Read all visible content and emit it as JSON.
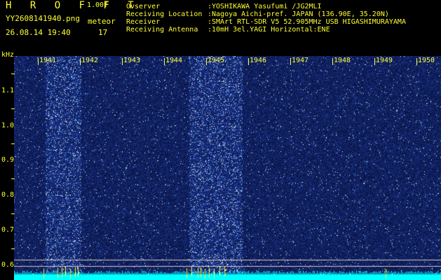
{
  "header": {
    "app_title": "H R O F F T",
    "version": "1.00f",
    "file_name": "YY2608141940.png",
    "meteor_label": "meteor",
    "timestamp": "26.08.14 19:40",
    "meteor_count": "17"
  },
  "info": [
    {
      "key": "Ovserver",
      "value": ":YOSHIKAWA Yasufumi /JG2MLI"
    },
    {
      "key": "Receiving Location",
      "value": ":Nagoya Aichi-pref. JAPAN (136.90E, 35.20N)"
    },
    {
      "key": "Receiver",
      "value": ":SMArt RTL-SDR V5 52.905MHz USB HIGASHIMURAYAMA"
    },
    {
      "key": "Receiving Antenna",
      "value": ":10mH 3el.YAGI Horizontal:ENE"
    }
  ],
  "axis": {
    "y_unit": "kHz",
    "y_labels": [
      "1.1",
      "1.0",
      "0.9",
      "0.8",
      "0.7",
      "0.6"
    ],
    "x_labels": [
      "1941",
      "1942",
      "1943",
      "1944",
      "1945",
      "1946",
      "1947",
      "1948",
      "1949",
      "1950"
    ]
  },
  "colors": {
    "text": "#ffff33",
    "background": "#000000",
    "noise_base": "#1a2a9a",
    "noise_bright": "#88ccff",
    "baseline": "#00ffff"
  }
}
